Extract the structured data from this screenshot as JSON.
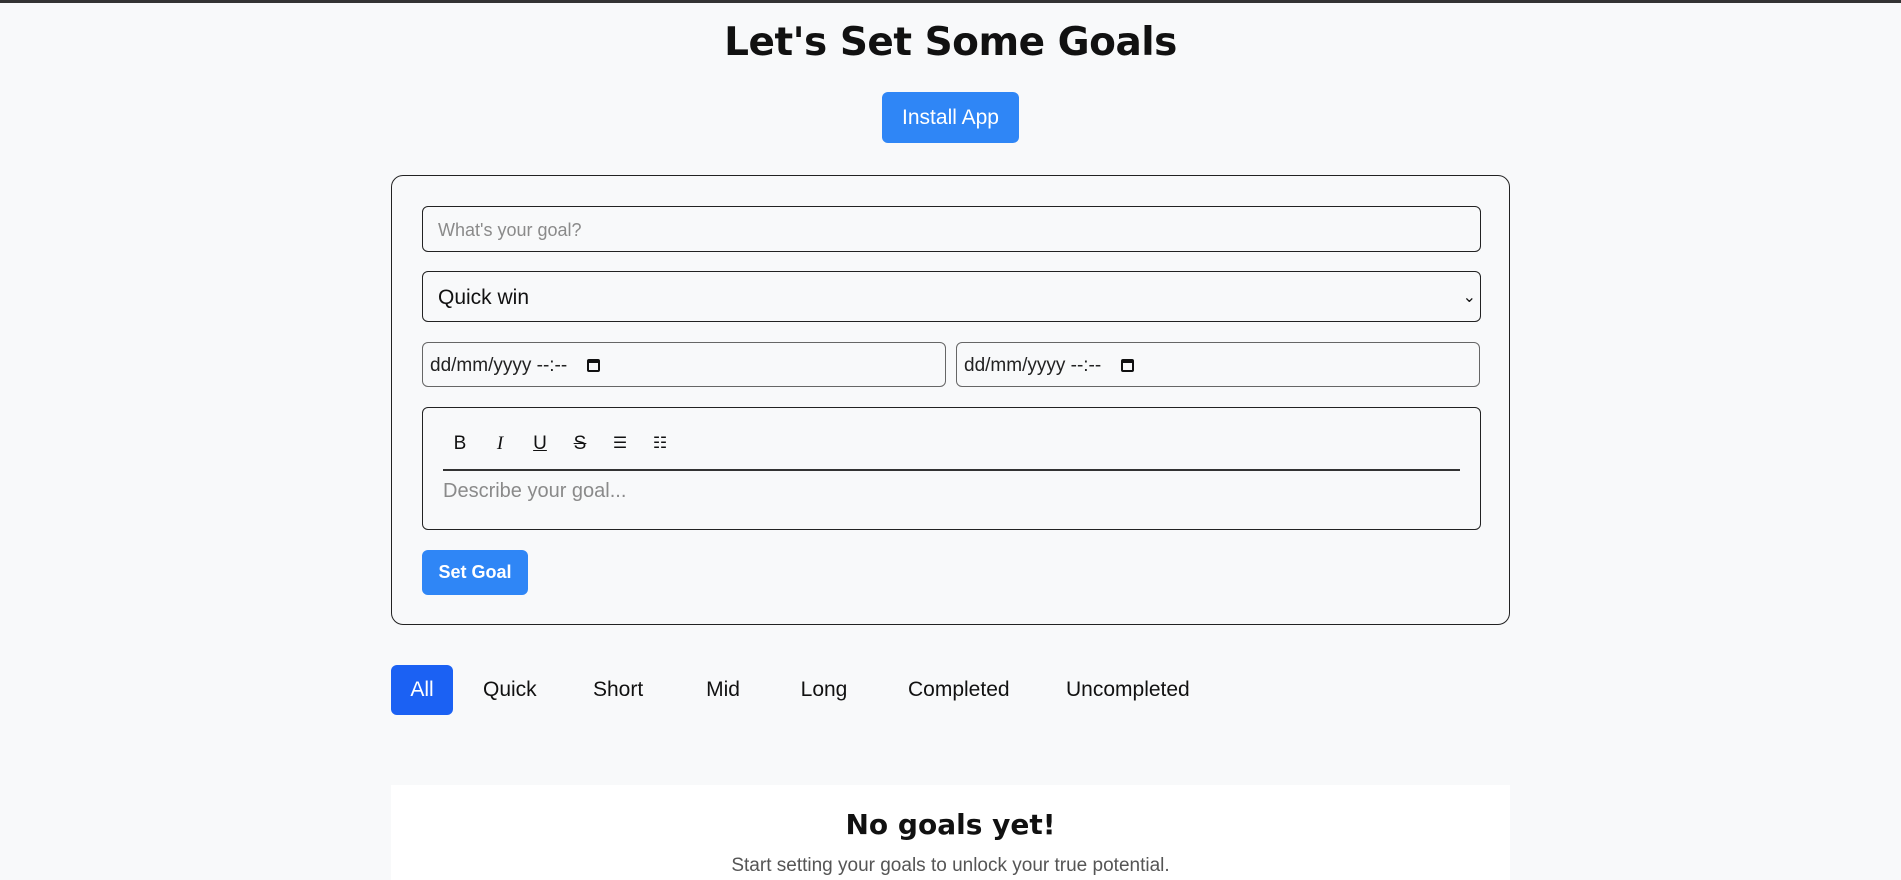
{
  "header": {
    "title": "Let's Set Some Goals",
    "install_label": "Install App"
  },
  "form": {
    "goal_placeholder": "What's your goal?",
    "category_selected": "Quick win",
    "start_date_placeholder": "dd/mm/yyyy --:--",
    "end_date_placeholder": "dd/mm/yyyy --:--",
    "toolbar": {
      "bold": "B",
      "italic": "I",
      "underline": "U",
      "strike": "S",
      "bullet_list": "☰",
      "ordered_list": "☷"
    },
    "description_placeholder": "Describe your goal...",
    "submit_label": "Set Goal"
  },
  "filters": [
    {
      "label": "All",
      "active": true
    },
    {
      "label": "Quick",
      "active": false
    },
    {
      "label": "Short",
      "active": false
    },
    {
      "label": "Mid",
      "active": false
    },
    {
      "label": "Long",
      "active": false
    },
    {
      "label": "Completed",
      "active": false
    },
    {
      "label": "Uncompleted",
      "active": false
    }
  ],
  "empty_state": {
    "title": "No goals yet!",
    "subtitle": "Start setting your goals to unlock your true potential."
  },
  "colors": {
    "primary": "#2f86f6",
    "active_filter": "#1b61f3",
    "background": "#f8f9fa"
  }
}
